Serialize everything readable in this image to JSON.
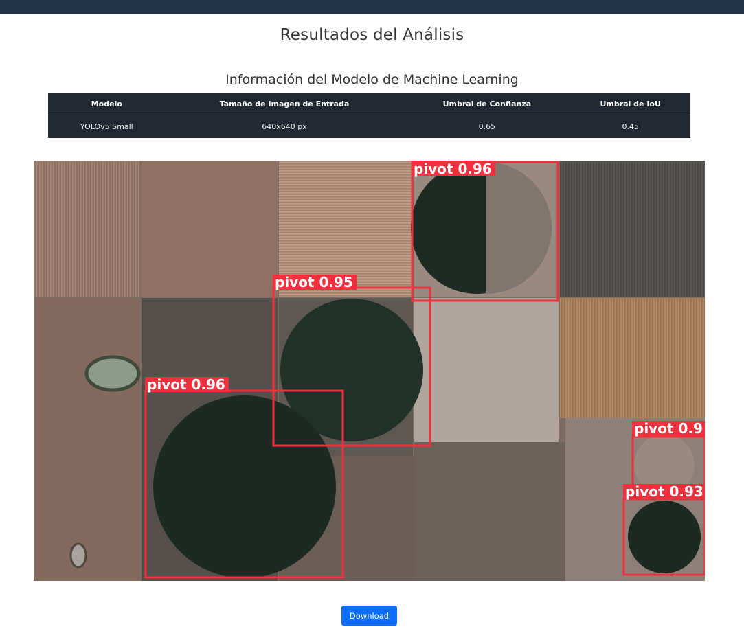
{
  "page": {
    "title": "Resultados del Análisis",
    "model_section_title": "Información del Modelo de Machine Learning"
  },
  "model_table": {
    "headers": [
      "Modelo",
      "Tamaño de Imagen de Entrada",
      "Umbral de Confianza",
      "Umbral de IoU"
    ],
    "row": [
      "YOLOv5 Small",
      "640x640 px",
      "0.65",
      "0.45"
    ]
  },
  "detections": [
    {
      "label": "pivot 0.96"
    },
    {
      "label": "pivot 0.95"
    },
    {
      "label": "pivot 0.96"
    },
    {
      "label": "pivot 0.9"
    },
    {
      "label": "pivot 0.93"
    }
  ],
  "colors": {
    "topbar": "#223449",
    "table_bg": "#222831",
    "box": "#f0303c",
    "button": "#0d6efd"
  },
  "actions": {
    "download_label": "Download"
  }
}
